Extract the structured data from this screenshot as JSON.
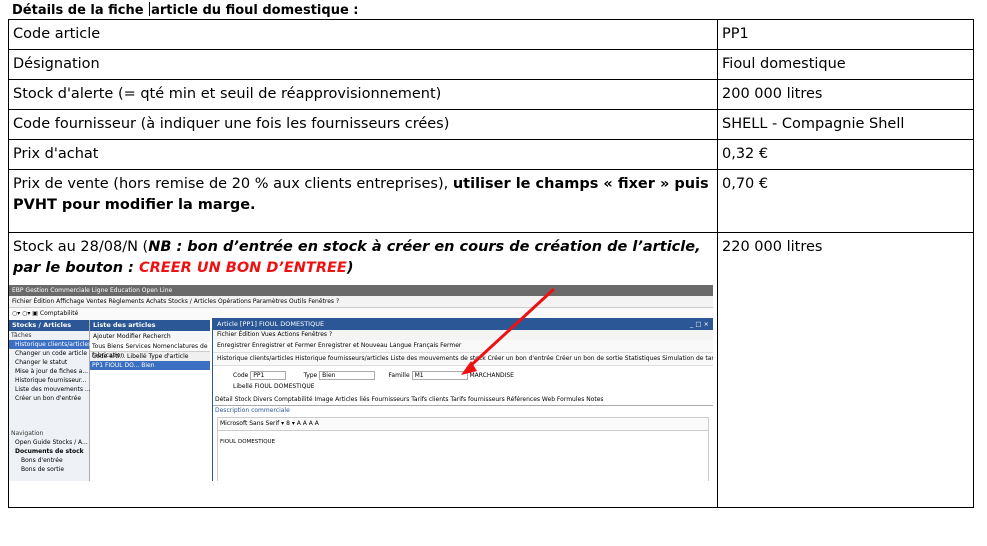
{
  "heading_part1": "Détails de la fiche",
  "heading_part2": "article du fioul domestique :",
  "rows": [
    {
      "label": "Code article",
      "value": "PP1"
    },
    {
      "label": "Désignation",
      "value": "Fioul domestique"
    },
    {
      "label": "Stock d'alerte (= qté min et seuil de réapprovisionnement)",
      "value": "200 000 litres"
    },
    {
      "label": "Code fournisseur (à indiquer une fois les fournisseurs crées)",
      "value": "SHELL  - Compagnie Shell"
    },
    {
      "label": "Prix d'achat",
      "value": "0,32 €"
    }
  ],
  "prix_vente": {
    "normal": "Prix de vente (hors remise de 20 % aux clients entreprises), ",
    "bold": "utiliser le champs « fixer » puis PVHT pour modifier la marge.",
    "value": "0,70 €"
  },
  "stock": {
    "p1": "Stock au 28/08/N (",
    "bi": "NB : bon d’entrée en stock à créer en cours de création de l’article, par le bouton : ",
    "red": "CREER UN BON D’ENTREE",
    "p2": ")",
    "value": "220 000 litres"
  },
  "shot": {
    "app_title": "EBP Gestion Commerciale Ligne Education Open Line",
    "menu": "Fichier   Édition   Affichage   Ventes   Règlements   Achats   Stocks / Articles   Opérations   Paramètres   Outils   Fenêtres   ?",
    "toolbar": "Comptabilité",
    "left_header": "Stocks / Articles",
    "left_section": "Tâches",
    "left_items": [
      "Historique clients/articles",
      "Changer un code article",
      "Changer le statut",
      "Mise à jour de fiches a...",
      "Historique fournisseur...",
      "Liste des mouvements ...",
      "Créer un bon d'entrée"
    ],
    "nav_section": "Navigation",
    "nav_items": [
      "Open Guide Stocks / A...",
      "Documents de stock",
      "Bons d'entrée",
      "Bons de sortie"
    ],
    "mid_header": "Liste des articles",
    "mid_bar": "Ajouter  Modifier  Recherch",
    "mid_tabs": "Tous  Biens  Services  Nomenclatures de fabrication",
    "mid_cols": "Code arti...  Libellé  Type d'article",
    "mid_row": "PP1   FIOUL DO...   Bien",
    "win_title": "Article [PP1] FIOUL DOMESTIQUE",
    "win_ctl": "_ □ ×",
    "win_menu": "Fichier   Édition   Vues   Actions   Fenêtres   ?",
    "win_bar1": "Enregistrer   Enregistrer et Fermer   Enregistrer et Nouveau     Langue  Français     Fermer",
    "win_bar2": "Historique clients/articles   Historique fournisseurs/articles   Liste des mouvements de stock   Créer un bon d'entrée   Créer un bon de sortie   Statistiques   Simulation de tarif client   Simulation de tarif fournisseur",
    "code_label": "Code",
    "code_value": "PP1",
    "type_label": "Type",
    "type_value": "Bien",
    "famille_label": "Famille",
    "famille_value": "M1",
    "famille_name": "MARCHANDISE",
    "libelle_label": "Libellé",
    "libelle_value": "FIOUL DOMESTIQUE",
    "detail_tabs": "Détail  Stock  Divers  Comptabilité  Image  Articles liés  Fournisseurs  Tarifs clients  Tarifs fournisseurs  Références  Web  Formules  Notes",
    "desc_label": "Description commerciale",
    "editor": "Microsoft Sans Serif ▾  8 ▾  A A A A",
    "desc_text": "FIOUL DOMESTIQUE"
  }
}
